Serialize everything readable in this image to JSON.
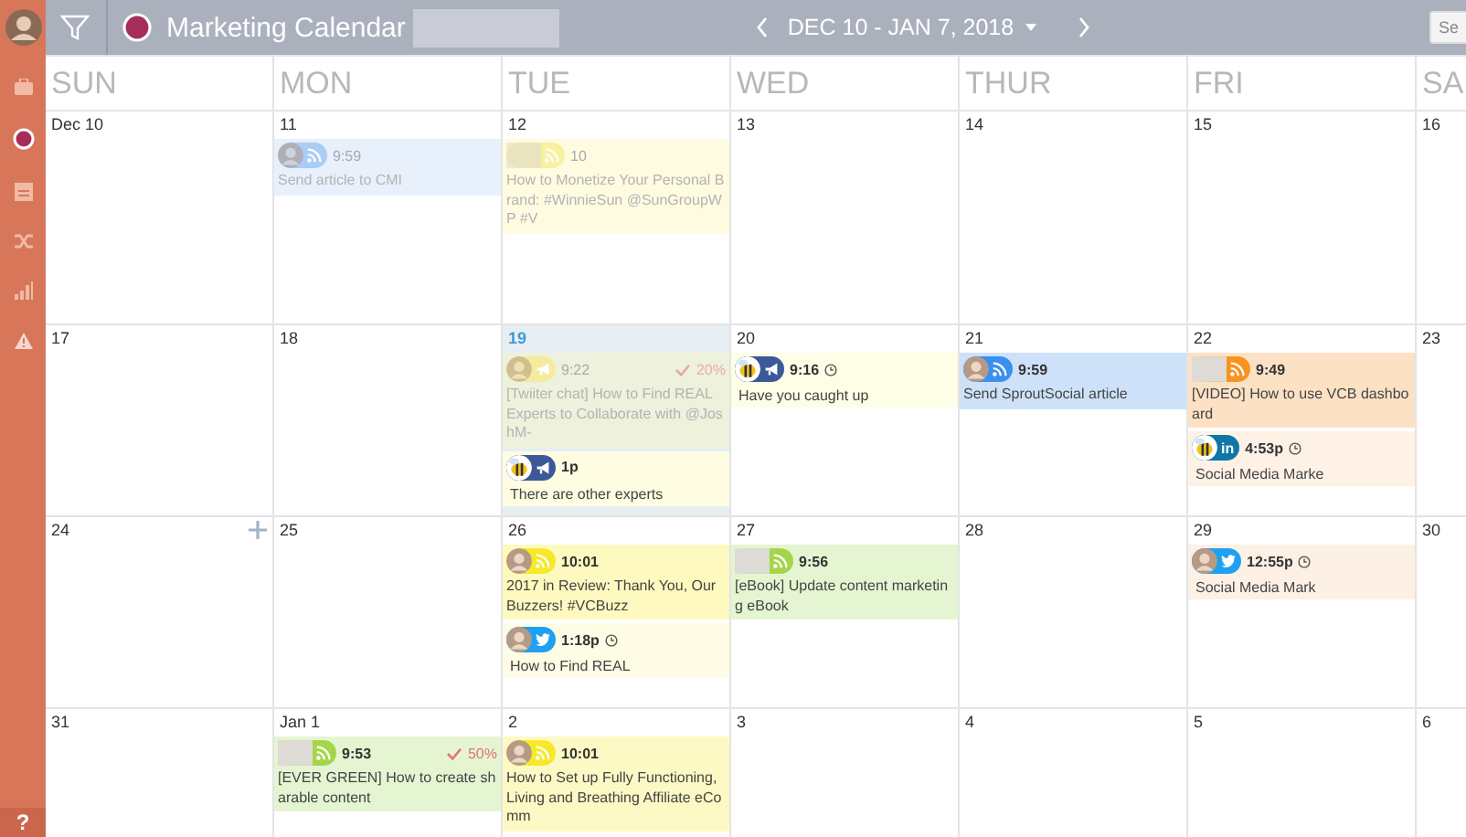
{
  "header": {
    "title": "Marketing Calendar",
    "date_range": "DEC 10 - JAN 7, 2018",
    "search": {
      "placeholder": "Se"
    }
  },
  "sidebar": {
    "items": [
      {
        "kind": "briefcase"
      },
      {
        "kind": "circle"
      },
      {
        "kind": "calendar"
      },
      {
        "kind": "shuffle"
      },
      {
        "kind": "chart"
      },
      {
        "kind": "warning"
      }
    ],
    "help": "?"
  },
  "day_names": [
    "SUN",
    "MON",
    "TUE",
    "WED",
    "THUR",
    "FRI",
    "SA"
  ],
  "weeks": [
    {
      "days": [
        {
          "date": "Dec 10",
          "today": false,
          "add_button": false
        },
        {
          "date": "11",
          "today": false,
          "add_button": false,
          "events": [
            {
              "kind": "block",
              "avatar": {
                "kind": "person"
              },
              "channel": {
                "kind": "rss",
                "color": "#a9cdf5"
              },
              "time": "9:59",
              "clock": false,
              "title": "Send article to CMI",
              "faded": true,
              "color": "#e7f0fb"
            }
          ]
        },
        {
          "date": "12",
          "today": false,
          "add_button": false,
          "events": [
            {
              "kind": "block",
              "avatar": {
                "kind": "blank"
              },
              "channel": {
                "kind": "rss",
                "color": "#f8f1a0"
              },
              "time": "10",
              "clock": false,
              "title": "How to Monetize Your Personal Brand: #WinnieSun @SunGroupWP #V",
              "faded": true,
              "color": "#fefbe1"
            }
          ]
        },
        {
          "date": "13",
          "today": false,
          "add_button": false
        },
        {
          "date": "14",
          "today": false,
          "add_button": false
        },
        {
          "date": "15",
          "today": false,
          "add_button": false
        },
        {
          "date": "16",
          "today": false,
          "add_button": false
        }
      ]
    },
    {
      "days": [
        {
          "date": "17",
          "today": false,
          "add_button": false
        },
        {
          "date": "18",
          "today": false,
          "add_button": false
        },
        {
          "date": "19",
          "today": true,
          "add_button": false,
          "events": [
            {
              "kind": "block",
              "avatar": {
                "kind": "person"
              },
              "channel": {
                "kind": "megaphone",
                "color": "#f3ec9e"
              },
              "time": "9:22",
              "clock": false,
              "progress": "20%",
              "title": "[Twiiter chat] How to Find REAL Experts to Collaborate with @JoshM-",
              "faded": true,
              "color": "#eef1dc"
            },
            {
              "kind": "inline",
              "avatar": {
                "kind": "bee"
              },
              "channel": {
                "kind": "megaphone",
                "color": "#3b5998"
              },
              "time": "1p",
              "clock": false,
              "title": "There are other experts",
              "faded": false,
              "color": "#fefde2"
            }
          ]
        },
        {
          "date": "20",
          "today": false,
          "add_button": false,
          "events": [
            {
              "kind": "inline",
              "avatar": {
                "kind": "bee"
              },
              "channel": {
                "kind": "megaphone",
                "color": "#3b5998"
              },
              "time": "9:16",
              "clock": true,
              "title": "Have you caught up",
              "faded": false,
              "color": "#fefde6"
            }
          ]
        },
        {
          "date": "21",
          "today": false,
          "add_button": false,
          "events": [
            {
              "kind": "block",
              "avatar": {
                "kind": "person"
              },
              "channel": {
                "kind": "rss",
                "color": "#3b8ff0"
              },
              "time": "9:59",
              "clock": false,
              "title": "Send SproutSocial article",
              "faded": false,
              "color": "#cde2f9"
            }
          ]
        },
        {
          "date": "22",
          "today": false,
          "add_button": false,
          "events": [
            {
              "kind": "block",
              "avatar": {
                "kind": "blank"
              },
              "channel": {
                "kind": "rss",
                "color": "#f7931e"
              },
              "time": "9:49",
              "clock": false,
              "title": "[VIDEO] How to use VCB dashboard",
              "faded": false,
              "color": "#fde1c5"
            },
            {
              "kind": "inline",
              "avatar": {
                "kind": "bee"
              },
              "channel": {
                "kind": "linkedin",
                "color": "#0e76a8",
                "label": "in"
              },
              "time": "4:53p",
              "clock": true,
              "title": "Social Media Marke",
              "faded": false,
              "color": "#fef2e6"
            }
          ]
        },
        {
          "date": "23",
          "today": false,
          "add_button": false
        }
      ]
    },
    {
      "days": [
        {
          "date": "24",
          "today": false,
          "add_button": true
        },
        {
          "date": "25",
          "today": false,
          "add_button": false
        },
        {
          "date": "26",
          "today": false,
          "add_button": false,
          "events": [
            {
              "kind": "block",
              "avatar": {
                "kind": "person"
              },
              "channel": {
                "kind": "rss",
                "color": "#f5e92a"
              },
              "time": "10:01",
              "clock": false,
              "title": "2017 in Review: Thank You, Our Buzzers! #VCBuzz",
              "faded": false,
              "color": "#fdf9bf"
            },
            {
              "kind": "inline",
              "avatar": {
                "kind": "person"
              },
              "channel": {
                "kind": "twitter",
                "color": "#1da1f2"
              },
              "time": "1:18p",
              "clock": true,
              "title": "How to Find REAL",
              "faded": false,
              "color": "#fefce4"
            }
          ]
        },
        {
          "date": "27",
          "today": false,
          "add_button": false,
          "events": [
            {
              "kind": "block",
              "avatar": {
                "kind": "blank"
              },
              "channel": {
                "kind": "rss",
                "color": "#a5d64a"
              },
              "time": "9:56",
              "clock": false,
              "title": "[eBook] Update content marketing eBook",
              "faded": false,
              "color": "#e5f5d2"
            }
          ]
        },
        {
          "date": "28",
          "today": false,
          "add_button": false
        },
        {
          "date": "29",
          "today": false,
          "add_button": false,
          "events": [
            {
              "kind": "inline",
              "avatar": {
                "kind": "person"
              },
              "channel": {
                "kind": "twitter",
                "color": "#1da1f2"
              },
              "time": "12:55p",
              "clock": true,
              "title": "Social Media Mark",
              "faded": false,
              "color": "#fdf0e4"
            }
          ]
        },
        {
          "date": "30",
          "today": false,
          "add_button": false
        }
      ]
    },
    {
      "days": [
        {
          "date": "31",
          "today": false,
          "add_button": false
        },
        {
          "date": "Jan 1",
          "today": false,
          "add_button": false,
          "events": [
            {
              "kind": "block",
              "avatar": {
                "kind": "blank"
              },
              "channel": {
                "kind": "rss",
                "color": "#a5d64a"
              },
              "time": "9:53",
              "clock": false,
              "progress": "50%",
              "title": "[EVER GREEN] How to create sharable content",
              "faded": false,
              "color": "#e5f5d2"
            }
          ]
        },
        {
          "date": "2",
          "today": false,
          "add_button": false,
          "events": [
            {
              "kind": "block",
              "avatar": {
                "kind": "person"
              },
              "channel": {
                "kind": "rss",
                "color": "#f5e92a"
              },
              "time": "10:01",
              "clock": false,
              "title": "How to Set up Fully Functioning, Living and Breathing Affiliate eComm",
              "faded": false,
              "color": "#fdf9c4"
            }
          ]
        },
        {
          "date": "3",
          "today": false,
          "add_button": false
        },
        {
          "date": "4",
          "today": false,
          "add_button": false
        },
        {
          "date": "5",
          "today": false,
          "add_button": false
        },
        {
          "date": "6",
          "today": false,
          "add_button": false
        }
      ]
    }
  ]
}
